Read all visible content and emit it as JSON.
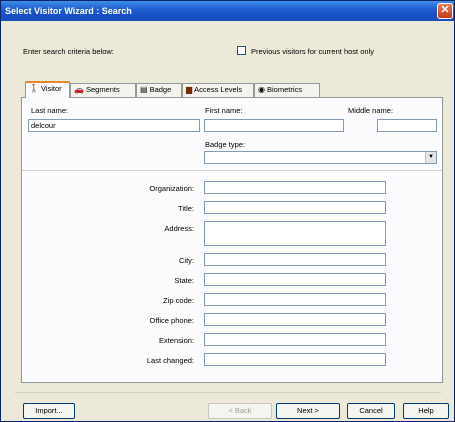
{
  "window": {
    "title": "Select Visitor Wizard : Search",
    "close": "✕"
  },
  "criteria": {
    "prompt": "Enter search criteria below:",
    "previous_visitors_label": "Previous visitors for current host only"
  },
  "tabs": [
    {
      "label": "Visitor",
      "icon": "person-icon",
      "glyph": "🚶"
    },
    {
      "label": "Segments",
      "icon": "segments-icon",
      "glyph": "🚗"
    },
    {
      "label": "Badge",
      "icon": "badge-icon",
      "glyph": "▤"
    },
    {
      "label": "Access Levels",
      "icon": "access-icon",
      "glyph": "▆"
    },
    {
      "label": "Biometrics",
      "icon": "biometrics-icon",
      "glyph": "◉"
    }
  ],
  "visitor": {
    "last_name_label": "Last name:",
    "last_name_value": "delcour",
    "first_name_label": "First name:",
    "first_name_value": "",
    "middle_name_label": "Middle name:",
    "middle_name_value": "",
    "badge_type_label": "Badge type:",
    "badge_type_value": ""
  },
  "details": {
    "organization": "Organization:",
    "title": "Title:",
    "address": "Address:",
    "city": "City:",
    "state": "State:",
    "zip": "Zip code:",
    "office_phone": "Office phone:",
    "extension": "Extension:",
    "last_changed": "Last changed:"
  },
  "buttons": {
    "import": "Import...",
    "back": "< Back",
    "next": "Next >",
    "cancel": "Cancel",
    "help": "Help"
  }
}
